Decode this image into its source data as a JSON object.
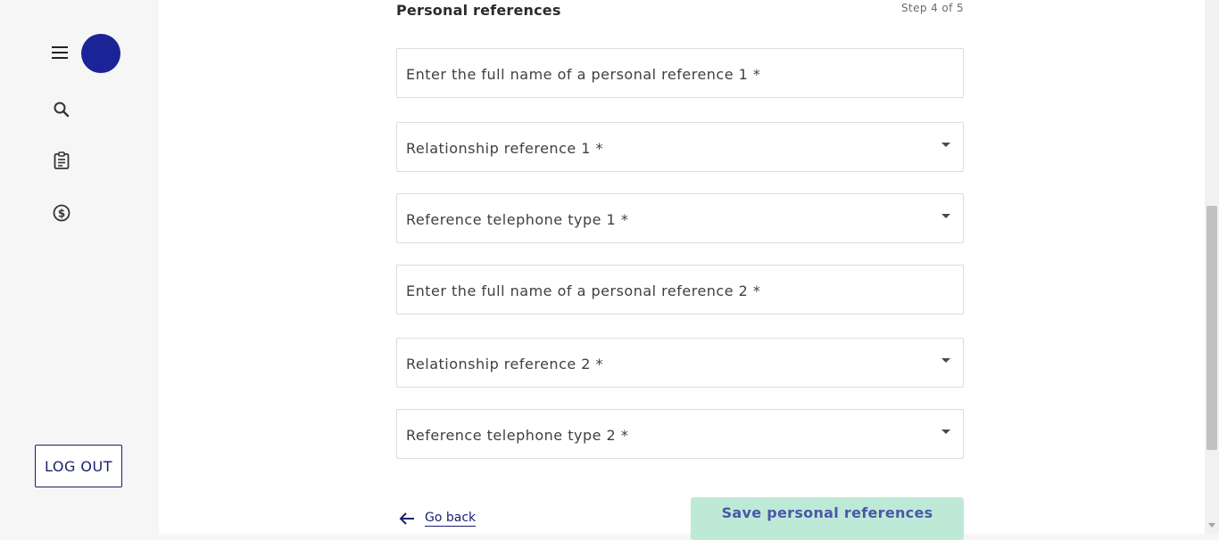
{
  "sidebar": {
    "icons": [
      "menu-icon",
      "search-icon",
      "clipboard-icon",
      "dollar-icon"
    ],
    "avatar_color": "#1a2496",
    "logout_label": "LOG OUT"
  },
  "form": {
    "section_title": "Personal references",
    "step_text": "Step 4 of 5",
    "fields": [
      {
        "label": "Enter the full name of a personal reference 1 *",
        "kind": "text"
      },
      {
        "label": "Relationship reference 1 *",
        "kind": "select"
      },
      {
        "label": "Reference telephone type 1 *",
        "kind": "select"
      },
      {
        "label": "Enter the full name of a personal reference 2 *",
        "kind": "text"
      },
      {
        "label": "Relationship reference 2 *",
        "kind": "select"
      },
      {
        "label": "Reference telephone type 2 *",
        "kind": "select"
      }
    ],
    "go_back_label": "Go back",
    "save_label": "Save personal references"
  },
  "colors": {
    "accent": "#1a1f6e",
    "save_button_bg": "#bfe9d7",
    "save_button_text": "#4a57a8"
  }
}
